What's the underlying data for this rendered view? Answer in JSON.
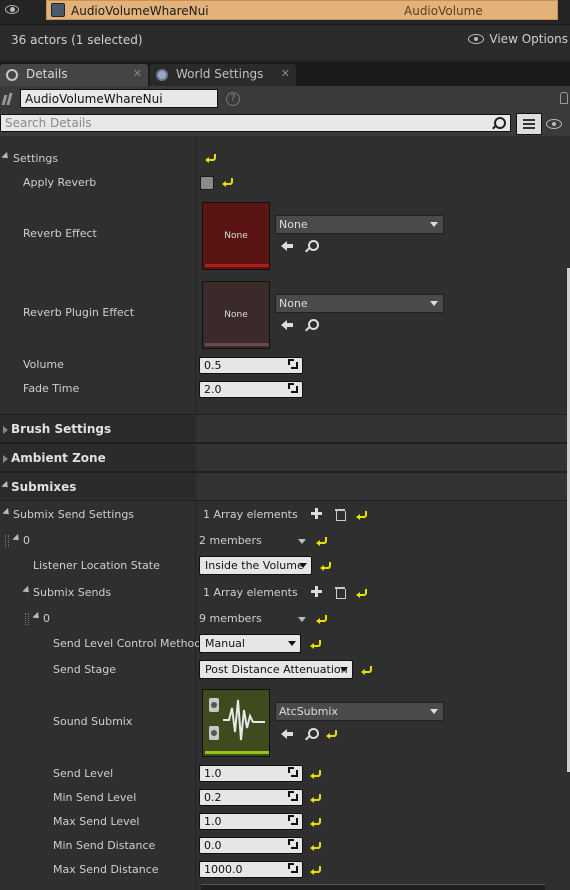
{
  "outliner": {
    "selected_name": "AudioVolumeWhareNui",
    "selected_type": "AudioVolume",
    "actor_count": "36 actors (1 selected)",
    "view_options": "View Options"
  },
  "tabs": [
    {
      "label": "Details"
    },
    {
      "label": "World Settings"
    }
  ],
  "details": {
    "actor_name": "AudioVolumeWhareNui",
    "search_placeholder": "Search Details",
    "help": "?"
  },
  "reverb": {
    "settings_label": "Settings",
    "apply_reverb_label": "Apply Reverb",
    "reverb_effect_label": "Reverb Effect",
    "reverb_effect_value": "None",
    "reverb_effect_thumb": "None",
    "reverb_plugin_label": "Reverb Plugin Effect",
    "reverb_plugin_value": "None",
    "reverb_plugin_thumb": "None",
    "volume_label": "Volume",
    "volume_value": "0.5",
    "fade_time_label": "Fade Time",
    "fade_time_value": "2.0"
  },
  "categories": {
    "brush_settings": "Brush Settings",
    "ambient_zone": "Ambient Zone",
    "submixes": "Submixes"
  },
  "submixes": {
    "send_settings_label": "Submix Send Settings",
    "send_settings_count": "1 Array elements",
    "element0_index": "0",
    "element0_members": "2 members",
    "listener_state_label": "Listener Location State",
    "listener_state_value": "Inside the Volume",
    "submix_sends_label": "Submix Sends",
    "submix_sends_count": "1 Array elements",
    "send0_index": "0",
    "send0_members": "9 members",
    "control_method_label": "Send Level Control Method",
    "control_method_value": "Manual",
    "send_stage_label": "Send Stage",
    "send_stage_value": "Post Distance Attenuation",
    "sound_submix_label": "Sound Submix",
    "sound_submix_value": "AtcSubmix",
    "send_level_label": "Send Level",
    "send_level_value": "1.0",
    "min_send_level_label": "Min Send Level",
    "min_send_level_value": "0.2",
    "max_send_level_label": "Max Send Level",
    "max_send_level_value": "1.0",
    "min_send_distance_label": "Min Send Distance",
    "min_send_distance_value": "0.0",
    "max_send_distance_label": "Max Send Distance",
    "max_send_distance_value": "1000.0"
  },
  "colors": {
    "selection": "#e2b27a",
    "reverb_thumb": "#5a1414",
    "plugin_thumb": "#3a2a2a",
    "submix_thumb": "#3f4a1e",
    "reset_arrow": "#e8e000"
  }
}
